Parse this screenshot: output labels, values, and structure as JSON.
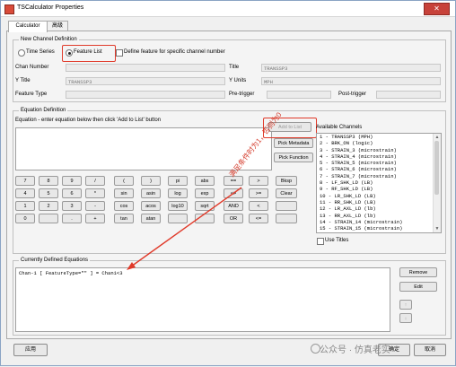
{
  "window": {
    "title": "TSCalculator Properties",
    "close_symbol": "✕"
  },
  "tabs": [
    {
      "label": "Calculator"
    },
    {
      "label": "高级"
    }
  ],
  "new_channel": {
    "legend": "New Channel Definition",
    "time_series_label": "Time Series",
    "feature_list_label": "Feature List",
    "define_feature_label": "Define feature for specific channel number",
    "chan_number_label": "Chan Number",
    "chan_number_value": "",
    "title_label": "Title",
    "title_value": "TRANSSP3",
    "ytitle_label": "Y Title",
    "ytitle_value": "TRANSSP3",
    "yunits_label": "Y Units",
    "yunits_value": "MPH",
    "feature_type_label": "Feature Type",
    "feature_type_value": "",
    "pretrigger_label": "Pre-trigger",
    "pretrigger_value": "",
    "posttrigger_label": "Post-trigger",
    "posttrigger_value": ""
  },
  "equation": {
    "legend": "Equation Definition",
    "instruction": "Equation - enter equation below then click 'Add to List' button",
    "add_to_list": "Add to List",
    "pick_metadata": "Pick Metadata",
    "pick_function": "Pick Function",
    "available_label": "Available Channels",
    "channels": [
      "1 - TRANSSP3 (MPH)",
      "2 - BRK_ON (logic)",
      "3 - STRAIN_3 (microstrain)",
      "4 - STRAIN_4 (microstrain)",
      "5 - STRAIN_5 (microstrain)",
      "6 - STRAIN_6 (microstrain)",
      "7 - STRAIN_7 (microstrain)",
      "8 - LF_SHK_LD (LB)",
      "9 - RF_SHK_LD (LB)",
      "10 - LR_SHK_LD (LB)",
      "11 - RR_SHK_LD (LB)",
      "12 - LR_AXL_LD (lb)",
      "13 - RR_AXL_LD (lb)",
      "14 - STRAIN_14 (microstrain)",
      "15 - STRAIN_15 (microstrain)"
    ],
    "use_titles": "Use Titles",
    "keypad": [
      [
        "7",
        "8",
        "9",
        "/",
        "(",
        ")",
        "pi",
        "abs",
        "==",
        ">",
        "Bksp"
      ],
      [
        "4",
        "5",
        "6",
        "*",
        "sin",
        "asin",
        "log",
        "exp",
        "<>",
        ">=",
        "Clear"
      ],
      [
        "1",
        "2",
        "3",
        "-",
        "cos",
        "acos",
        "log10",
        "sqrt",
        "AND",
        "<",
        ""
      ],
      [
        "0",
        "",
        ".",
        "+",
        "tan",
        "atan",
        "",
        "",
        "OR",
        "<=",
        ""
      ]
    ]
  },
  "current": {
    "legend": "Currently Defined Equations",
    "equations": [
      "Chan-1 [ FeatureType=\"\" ] = Chan1<3"
    ],
    "remove": "Remove",
    "edit": "Edit",
    "up_icon": "↑",
    "down_icon": "↓"
  },
  "footer": {
    "apply": "应用",
    "ok": "确定",
    "cancel": "取消"
  },
  "watermark": "公众号 · 仿真老实",
  "annotation": "满足条件时为1，否则为0",
  "colors": {
    "highlight": "#e03a2a",
    "window_border": "#8aa4c4"
  }
}
